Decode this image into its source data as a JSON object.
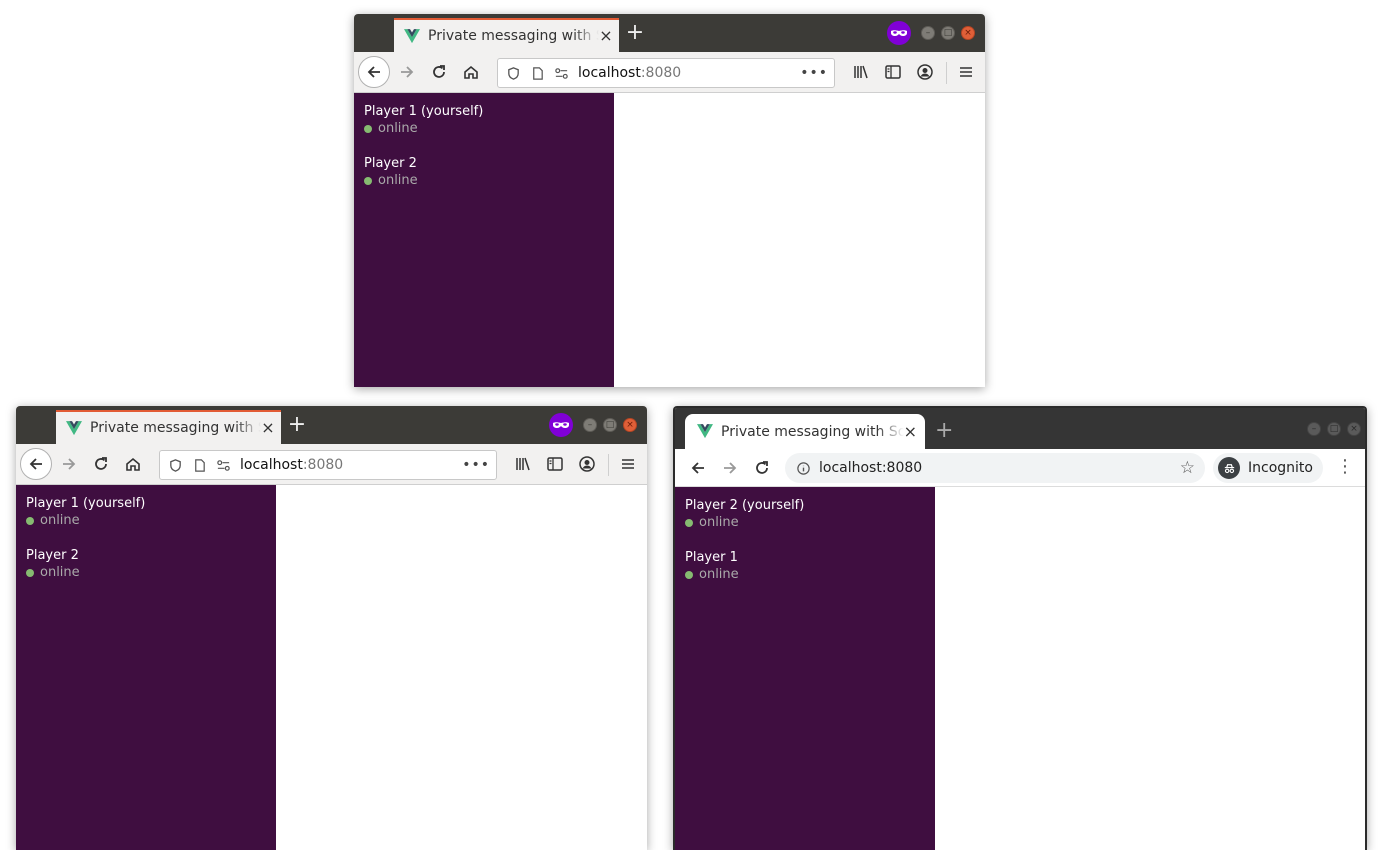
{
  "tab_title": "Private messaging with Socket.IO",
  "url": {
    "host": "localhost",
    "port": ":8080",
    "full": "localhost:8080"
  },
  "incognito_label": "Incognito",
  "colors": {
    "sidebar": "#3f0e40",
    "online": "#86bb71",
    "private_badge": "#8000d7",
    "close_button": "#e05f38"
  },
  "windows": [
    {
      "id": "firefox-private-top",
      "users": [
        {
          "name": "Player 1 (yourself)",
          "status": "online"
        },
        {
          "name": "Player 2",
          "status": "online"
        }
      ]
    },
    {
      "id": "firefox-private-bottom",
      "users": [
        {
          "name": "Player 1 (yourself)",
          "status": "online"
        },
        {
          "name": "Player 2",
          "status": "online"
        }
      ]
    },
    {
      "id": "chrome-incognito",
      "users": [
        {
          "name": "Player 2 (yourself)",
          "status": "online"
        },
        {
          "name": "Player 1",
          "status": "online"
        }
      ]
    }
  ]
}
